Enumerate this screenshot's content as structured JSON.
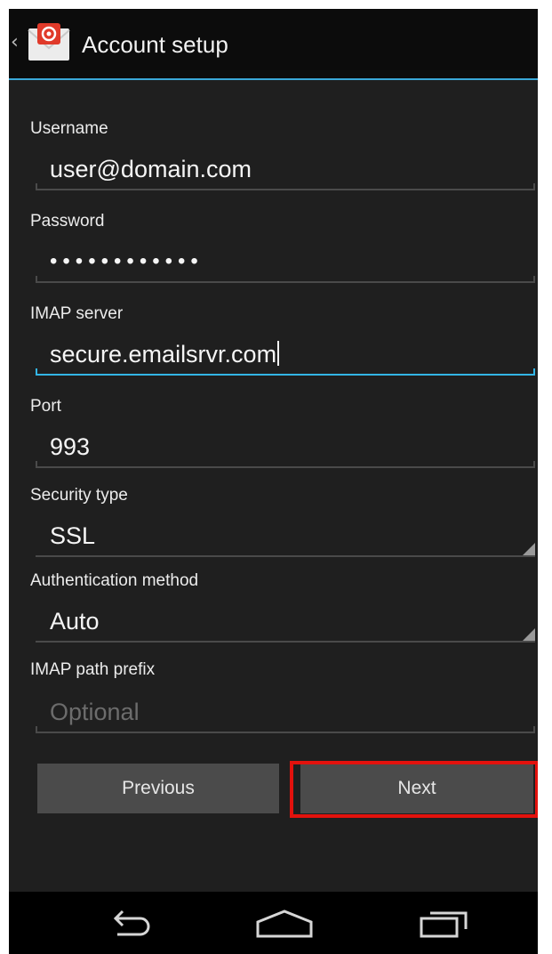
{
  "header": {
    "title": "Account setup",
    "back_glyph": "‹",
    "app_icon": "email-app-icon"
  },
  "form": {
    "username": {
      "label": "Username",
      "value": "user@domain.com"
    },
    "password": {
      "label": "Password",
      "value": "••••••••••••"
    },
    "imap_server": {
      "label": "IMAP server",
      "value": "secure.emailsrvr.com"
    },
    "port": {
      "label": "Port",
      "value": "993"
    },
    "security_type": {
      "label": "Security type",
      "value": "SSL"
    },
    "auth_method": {
      "label": "Authentication method",
      "value": "Auto"
    },
    "path_prefix": {
      "label": "IMAP path prefix",
      "value": "",
      "placeholder": "Optional"
    }
  },
  "buttons": {
    "previous": "Previous",
    "next": "Next"
  },
  "navbar": {
    "icons": [
      "back-icon",
      "home-icon",
      "recent-apps-icon"
    ]
  },
  "colors": {
    "accent": "#33b5e5",
    "highlight": "#e3120d",
    "background": "#1f1f1f",
    "button": "#4b4b4b"
  }
}
